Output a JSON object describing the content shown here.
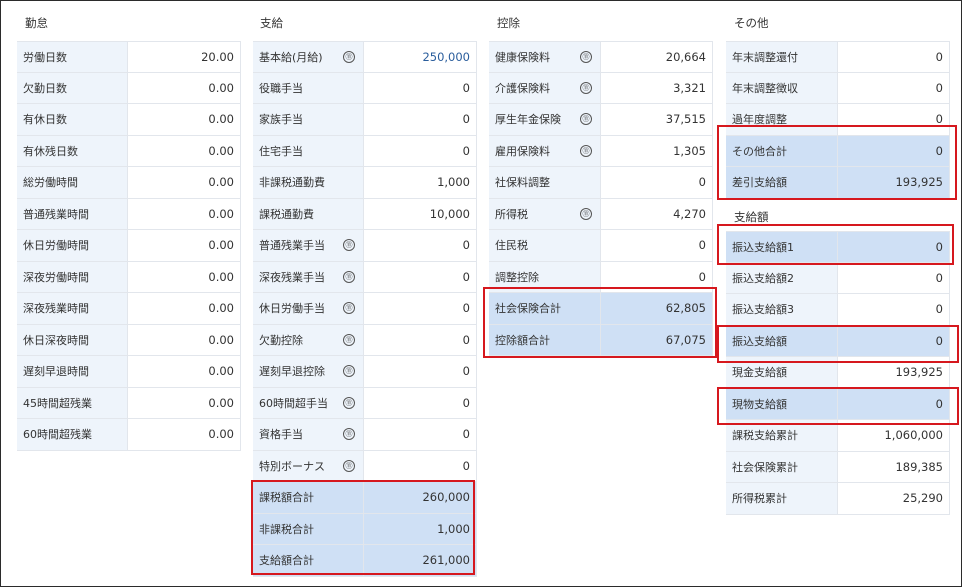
{
  "kintai": {
    "title": "勤怠",
    "rows": [
      {
        "label": "労働日数",
        "value": "20.00"
      },
      {
        "label": "欠勤日数",
        "value": "0.00"
      },
      {
        "label": "有休日数",
        "value": "0.00"
      },
      {
        "label": "有休残日数",
        "value": "0.00"
      },
      {
        "label": "総労働時間",
        "value": "0.00"
      },
      {
        "label": "普通残業時間",
        "value": "0.00"
      },
      {
        "label": "休日労働時間",
        "value": "0.00"
      },
      {
        "label": "深夜労働時間",
        "value": "0.00"
      },
      {
        "label": "深夜残業時間",
        "value": "0.00"
      },
      {
        "label": "休日深夜時間",
        "value": "0.00"
      },
      {
        "label": "遅刻早退時間",
        "value": "0.00"
      },
      {
        "label": "45時間超残業",
        "value": "0.00"
      },
      {
        "label": "60時間超残業",
        "value": "0.00"
      }
    ]
  },
  "shikyu": {
    "title": "支給",
    "rows": [
      {
        "label": "基本給(月給)",
        "value": "250,000",
        "badge": "⑪"
      },
      {
        "label": "役職手当",
        "value": "0"
      },
      {
        "label": "家族手当",
        "value": "0"
      },
      {
        "label": "住宅手当",
        "value": "0"
      },
      {
        "label": "非課税通勤費",
        "value": "1,000"
      },
      {
        "label": "課税通勤費",
        "value": "10,000"
      },
      {
        "label": "普通残業手当",
        "value": "0",
        "badge": "⑪"
      },
      {
        "label": "深夜残業手当",
        "value": "0",
        "badge": "⑪"
      },
      {
        "label": "休日労働手当",
        "value": "0",
        "badge": "⑪"
      },
      {
        "label": "欠勤控除",
        "value": "0",
        "badge": "⑪"
      },
      {
        "label": "遅刻早退控除",
        "value": "0",
        "badge": "⑪"
      },
      {
        "label": "60時間超手当",
        "value": "0",
        "badge": "⑪"
      },
      {
        "label": "資格手当",
        "value": "0",
        "badge": "⑪"
      },
      {
        "label": "特別ボーナス",
        "value": "0",
        "badge": "⑪"
      }
    ],
    "sum_rows": [
      {
        "label": "課税額合計",
        "value": "260,000"
      },
      {
        "label": "非課税合計",
        "value": "1,000"
      },
      {
        "label": "支給額合計",
        "value": "261,000"
      }
    ]
  },
  "kojo": {
    "title": "控除",
    "rows": [
      {
        "label": "健康保険料",
        "value": "20,664",
        "badge": "⑪"
      },
      {
        "label": "介護保険料",
        "value": "3,321",
        "badge": "⑪"
      },
      {
        "label": "厚生年金保険",
        "value": "37,515",
        "badge": "⑪"
      },
      {
        "label": "雇用保険料",
        "value": "1,305",
        "badge": "⑪"
      },
      {
        "label": "社保料調整",
        "value": "0"
      },
      {
        "label": "所得税",
        "value": "4,270",
        "badge": "⑪"
      },
      {
        "label": "住民税",
        "value": "0"
      },
      {
        "label": "調整控除",
        "value": "0"
      }
    ],
    "sum_rows": [
      {
        "label": "社会保険合計",
        "value": "62,805"
      },
      {
        "label": "控除額合計",
        "value": "67,075"
      }
    ]
  },
  "sonota": {
    "title": "その他",
    "rows": [
      {
        "label": "年末調整還付",
        "value": "0"
      },
      {
        "label": "年末調整徴収",
        "value": "0"
      },
      {
        "label": "過年度調整",
        "value": "0"
      }
    ],
    "sum_rows": [
      {
        "label": "その他合計",
        "value": "0"
      },
      {
        "label": "差引支給額",
        "value": "193,925"
      }
    ]
  },
  "shikyugaku": {
    "title": "支給額",
    "rows": [
      {
        "label": "振込支給額1",
        "value": "0",
        "sum": true
      },
      {
        "label": "振込支給額2",
        "value": "0"
      },
      {
        "label": "振込支給額3",
        "value": "0"
      },
      {
        "label": "振込支給額",
        "value": "0",
        "sum": true
      },
      {
        "label": "現金支給額",
        "value": "193,925"
      },
      {
        "label": "現物支給額",
        "value": "0",
        "sum": true
      },
      {
        "label": "課税支給累計",
        "value": "1,060,000"
      },
      {
        "label": "社会保険累計",
        "value": "189,385"
      },
      {
        "label": "所得税累計",
        "value": "25,290"
      }
    ]
  },
  "colors": {
    "highlight_border": "#d6181e",
    "sum_bg": "#cfe0f5",
    "label_bg": "#eef4fb",
    "blue_value": "#2a5d9c"
  }
}
